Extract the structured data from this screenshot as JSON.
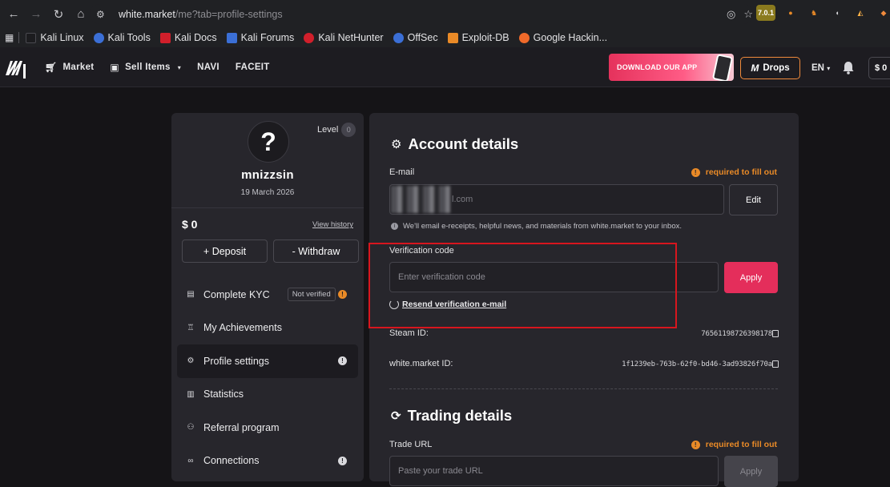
{
  "browser": {
    "url_host": "white.market",
    "url_path": "/me?tab=profile-settings",
    "bookmarks": [
      "Kali Linux",
      "Kali Tools",
      "Kali Docs",
      "Kali Forums",
      "Kali NetHunter",
      "OffSec",
      "Exploit-DB",
      "Google Hackin..."
    ],
    "extension_badge": "7.0.1"
  },
  "header": {
    "menu": [
      "Market",
      "Sell Items",
      "NAVI",
      "FACEIT"
    ],
    "app_banner": "DOWNLOAD OUR APP",
    "drops": "Drops",
    "language": "EN",
    "balance": "$ 0"
  },
  "profile": {
    "level_label": "Level",
    "level_value": "0",
    "avatar_glyph": "?",
    "username": "mnizzsin",
    "join_date": "19 March 2026",
    "balance": "$ 0",
    "view_history": "View history",
    "deposit": "+ Deposit",
    "withdraw": "- Withdraw",
    "nav": [
      {
        "label": "Complete KYC",
        "badge": "Not verified"
      },
      {
        "label": "My Achievements"
      },
      {
        "label": "Profile settings"
      },
      {
        "label": "Statistics"
      },
      {
        "label": "Referral program"
      },
      {
        "label": "Connections"
      }
    ]
  },
  "account": {
    "title": "Account details",
    "email_label": "E-mail",
    "required_text": "required to fill out",
    "email_visible_tail": "l.com",
    "edit": "Edit",
    "email_hint": "We'll email e-receipts, helpful news, and materials from white.market to your inbox.",
    "verification_label": "Verification code",
    "verification_placeholder": "Enter verification code",
    "apply": "Apply",
    "resend": "Resend verification e-mail",
    "steam_id_label": "Steam ID:",
    "steam_id": "76561198726398178",
    "wm_id_label": "white.market ID:",
    "wm_id": "1f1239eb-763b-62f0-bd46-3ad93826f70a"
  },
  "trading": {
    "title": "Trading details",
    "trade_url_label": "Trade URL",
    "required_text": "required to fill out",
    "trade_url_placeholder": "Paste your trade URL",
    "apply": "Apply"
  },
  "colors": {
    "accent_pink": "#e42e5b",
    "warning_orange": "#e98a27",
    "highlight_red": "#d7161e",
    "panel": "#27262c",
    "page_bg": "#151417"
  }
}
